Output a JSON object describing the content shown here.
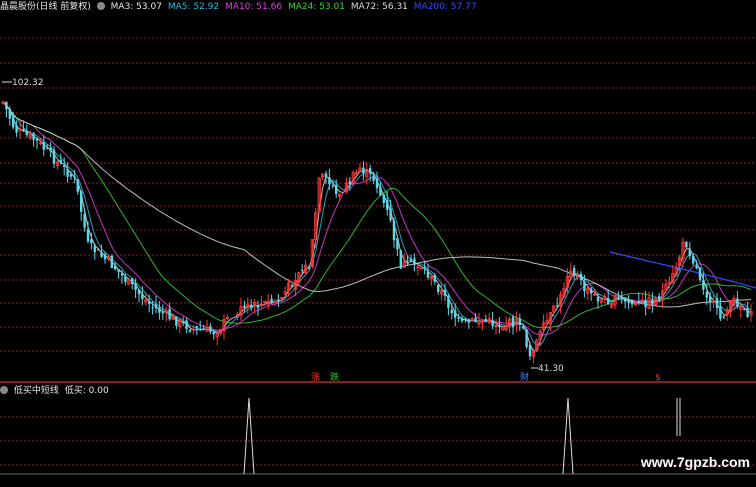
{
  "header": {
    "stock_name": "晶晨股份(日线 前复权)",
    "ma": [
      {
        "label": "MA3: 53.07",
        "color": "#e8e8e8"
      },
      {
        "label": "MA5: 52.92",
        "color": "#2fb8d8"
      },
      {
        "label": "MA10: 51.66",
        "color": "#e040e0"
      },
      {
        "label": "MA24: 53.01",
        "color": "#36d336"
      },
      {
        "label": "MA72: 56.31",
        "color": "#dddddd"
      },
      {
        "label": "MA200: 57.77",
        "color": "#3050ff"
      }
    ]
  },
  "main_chart": {
    "high_label": "102.32",
    "low_label": "41.30",
    "markers": [
      {
        "text": "涨",
        "color": "#ff3030"
      },
      {
        "text": "跌",
        "color": "#30c030"
      },
      {
        "text": "财",
        "color": "#3f88ff"
      },
      {
        "text": "$",
        "color": "#ff3030"
      }
    ]
  },
  "indicator": {
    "title": "低买中短线",
    "value_label": "低买: 0.00"
  },
  "watermark": "www.7gpzb.com",
  "colors": {
    "up": "#ff3a3a",
    "down": "#5fd9e8",
    "grid": "#8b1c1c",
    "divider": "#c02020",
    "signal": "#dddddd"
  }
}
